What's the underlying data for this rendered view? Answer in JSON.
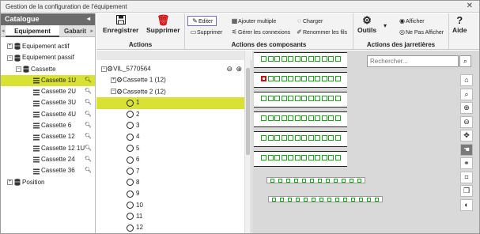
{
  "window": {
    "title": "Gestion de la configuration de l'équipement",
    "close_glyph": "✕"
  },
  "catalogue": {
    "title": "Catalogue",
    "collapse_glyph": "◂",
    "tabs": [
      "Equipement",
      "Gabarit"
    ],
    "tree": [
      {
        "label": "Equipement actif",
        "expander": "+",
        "level": 0
      },
      {
        "label": "Equipement passif",
        "expander": "−",
        "level": 0
      },
      {
        "label": "Cassette",
        "expander": "−",
        "level": 1
      },
      {
        "label": "Cassette 1U",
        "level": 2,
        "selected": true
      },
      {
        "label": "Cassette 2U",
        "level": 2
      },
      {
        "label": "Cassette 3U",
        "level": 2
      },
      {
        "label": "Cassette 4U",
        "level": 2
      },
      {
        "label": "Cassette 6",
        "level": 2
      },
      {
        "label": "Cassette 12",
        "level": 2
      },
      {
        "label": "Cassette 12 1U",
        "level": 2
      },
      {
        "label": "Cassette 24",
        "level": 2
      },
      {
        "label": "Cassette 36",
        "level": 2
      },
      {
        "label": "Position",
        "expander": "+",
        "level": 0
      }
    ]
  },
  "ribbon": {
    "actions": {
      "label": "Actions",
      "save": "Enregistrer",
      "delete": "Supprimer"
    },
    "components": {
      "label": "Actions des composants",
      "edit": "Editer",
      "remove": "Supprimer",
      "add_multiple": "Ajouter multiple",
      "manage_connections": "Gérer les connexions",
      "load": "Charger",
      "rename_wires": "Renommer les fils"
    },
    "jumpers": {
      "label": "Actions des jarretières",
      "tools": "Outils",
      "show": "Afficher",
      "hide": "Ne Pas Afficher"
    },
    "help": {
      "label": "Aide",
      "glyph": "?"
    }
  },
  "tree": {
    "root": "VIL_5770564",
    "items": [
      {
        "label": "Cassette 1 (12)",
        "expander": "+"
      },
      {
        "label": "Cassette 2 (12)",
        "expander": "−"
      }
    ],
    "ports": [
      "1",
      "2",
      "3",
      "4",
      "5",
      "6",
      "7",
      "8",
      "9",
      "10",
      "11",
      "12"
    ],
    "selected_port": "1"
  },
  "canvas": {
    "search_placeholder": "Rechercher...",
    "racks": 6,
    "cells_per_rack": 12,
    "highlighted": {
      "rack": 1,
      "cell": 0
    },
    "strips": [
      {
        "cells": 12
      },
      {
        "cells": 14
      }
    ],
    "tools": [
      "home-icon",
      "zoom-search-icon",
      "zoom-in-icon",
      "zoom-out-icon",
      "move-icon",
      "hand-icon",
      "link-icon",
      "crop-icon",
      "copy-icon",
      "toggle-icon"
    ],
    "colors": {
      "port_border": "#1ea51e",
      "selected_port": "#d01010",
      "selection": "#d8e234"
    }
  }
}
